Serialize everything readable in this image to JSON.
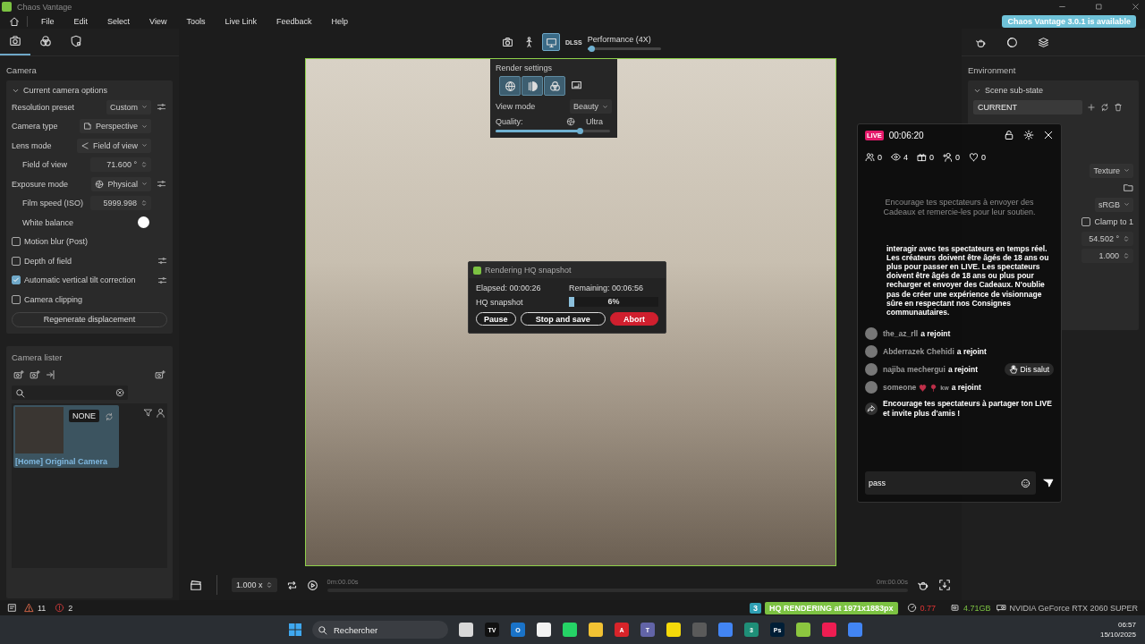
{
  "window": {
    "title": "Chaos Vantage",
    "update_badge": "Chaos Vantage 3.0.1 is available"
  },
  "menu": [
    "File",
    "Edit",
    "Select",
    "View",
    "Tools",
    "Live Link",
    "Feedback",
    "Help"
  ],
  "left_tabs": [
    {
      "selected": true
    },
    {
      "selected": false
    },
    {
      "selected": false
    }
  ],
  "camera_panel": {
    "title": "Camera",
    "section": "Current camera options",
    "expanded": true,
    "rows": [
      {
        "kind": "dropdown",
        "label": "Resolution preset",
        "value": "Custom",
        "adjust": true
      },
      {
        "kind": "dropdown",
        "label": "Camera type",
        "value": "Perspective",
        "adjust": false
      },
      {
        "kind": "dropdown",
        "label": "Lens mode",
        "value": "Field of view",
        "adjust": false,
        "children": [
          {
            "kind": "number",
            "label": "Field of view",
            "value": "71.600 °"
          }
        ]
      },
      {
        "kind": "dropdown",
        "label": "Exposure mode",
        "value": "Physical",
        "adjust": true,
        "children": [
          {
            "kind": "number",
            "label": "Film speed (ISO)",
            "value": "5999.998"
          },
          {
            "kind": "color",
            "label": "White balance",
            "color": "#ffffff"
          }
        ]
      },
      {
        "kind": "checkbox",
        "label": "Motion blur (Post)",
        "checked": false,
        "adjust": false
      },
      {
        "kind": "checkbox",
        "label": "Depth of field",
        "checked": false,
        "adjust": true
      },
      {
        "kind": "checkbox",
        "label": "Automatic vertical tilt correction",
        "checked": true,
        "adjust": true
      },
      {
        "kind": "checkbox",
        "label": "Camera clipping",
        "checked": false,
        "adjust": false
      },
      {
        "kind": "button",
        "label": "Regenerate displacement"
      }
    ]
  },
  "camera_lister": {
    "title": "Camera lister",
    "cameras": [
      {
        "badge": "NONE",
        "name": "[Home] Original Camera",
        "selected": true
      }
    ]
  },
  "viewport": {
    "tools": [
      {
        "selected": false
      },
      {
        "selected": false
      },
      {
        "selected": true
      }
    ],
    "dlss": "DLSS",
    "preset": "Performance (4X)",
    "preset_slider": {
      "level": 0.06
    }
  },
  "render_settings": {
    "title": "Render settings",
    "modes": [
      {
        "selected": true
      },
      {
        "selected": true
      },
      {
        "selected": true
      },
      {
        "selected": false
      }
    ],
    "view_mode_label": "View mode",
    "view_mode": "Beauty",
    "quality_label": "Quality:",
    "quality": "Ultra",
    "quality_slider": {
      "level": 0.74
    }
  },
  "hq_dialog": {
    "title": "Rendering HQ snapshot",
    "elapsed": "Elapsed: 00:00:26",
    "remaining": "Remaining: 00:06:56",
    "label": "HQ snapshot",
    "level": 0.06,
    "percent": "6%",
    "buttons": [
      {
        "label": "Pause",
        "kind": "outline"
      },
      {
        "label": "Stop and save",
        "kind": "outline"
      },
      {
        "label": "Abort",
        "kind": "danger"
      }
    ]
  },
  "live": {
    "badge": "LIVE",
    "time": "00:06:20",
    "stats": [
      {
        "kind": "users",
        "value": "0"
      },
      {
        "kind": "viewers",
        "value": "4"
      },
      {
        "kind": "gifts",
        "value": "0"
      },
      {
        "kind": "follows",
        "value": "0"
      },
      {
        "kind": "likes",
        "value": "0"
      }
    ],
    "hint": "Encourage tes spectateurs à envoyer des Cadeaux et remercie-les pour leur soutien.",
    "notice": "interagir avec tes spectateurs en temps réel. Les créateurs doivent être âgés de 18 ans ou plus pour passer en LIVE. Les spectateurs doivent être âgés de 18 ans ou plus pour recharger et envoyer des Cadeaux. N'oublie pas de créer une expérience de visionnage sûre en respectant nos Consignes communautaires.",
    "messages": [
      {
        "kind": "join",
        "user": "the_az_rll",
        "text": "a rejoint"
      },
      {
        "kind": "join",
        "user": "Abderrazek Chehidi",
        "text": "a rejoint"
      },
      {
        "kind": "join",
        "user": "najiba mechergui",
        "text": "a rejoint",
        "action": "Dis salut"
      },
      {
        "kind": "join",
        "user": "someone",
        "tail": "kw",
        "text": "a rejoint"
      },
      {
        "kind": "share",
        "text": "Encourage tes spectateurs à partager ton LIVE et invite plus d'amis !"
      }
    ],
    "input": {
      "value": "pass"
    }
  },
  "environment": {
    "title": "Environment",
    "substate_title": "Scene sub-state",
    "substate": "CURRENT",
    "values": [
      {
        "kind": "dropdown",
        "value": "Texture"
      },
      {
        "kind": "folder"
      },
      {
        "kind": "dropdown",
        "value": "sRGB"
      },
      {
        "kind": "checkbox",
        "label": "Clamp to 1",
        "checked": false
      },
      {
        "kind": "number",
        "value": "54.502 °"
      },
      {
        "kind": "number",
        "value": "1.000"
      }
    ]
  },
  "timeline": {
    "speed": "1.000 x",
    "start": "0m:00.00s",
    "end": "0m:00.00s"
  },
  "status_bar": {
    "warnings": "11",
    "errors": "2",
    "app_badge": "3",
    "render_badge": "HQ RENDERING at 1971x1883px",
    "fps": "0.77",
    "memory": "4.71GB",
    "gpu": "NVIDIA GeForce RTX 2060 SUPER"
  },
  "taskbar": {
    "search": "Rechercher",
    "time": "06:57",
    "date": "15/10/2025",
    "apps": [
      {
        "color": "#d8d8d8"
      },
      {
        "color": "#111111",
        "label": "TV"
      },
      {
        "color": "#1a73c8",
        "label": "O"
      },
      {
        "color": "#f2f2f2"
      },
      {
        "color": "#25d366"
      },
      {
        "color": "#f2c233"
      },
      {
        "color": "#d8242a",
        "label": "A"
      },
      {
        "color": "#6264a7",
        "label": "T"
      },
      {
        "color": "#f5d90a"
      },
      {
        "color": "#5a5a5a"
      },
      {
        "color": "#4285f4"
      },
      {
        "color": "#1f8f78",
        "label": "3"
      },
      {
        "color": "#001e36",
        "label": "Ps"
      },
      {
        "color": "#8cc63f"
      },
      {
        "color": "#ee1d52"
      },
      {
        "color": "#4285f4"
      }
    ]
  }
}
